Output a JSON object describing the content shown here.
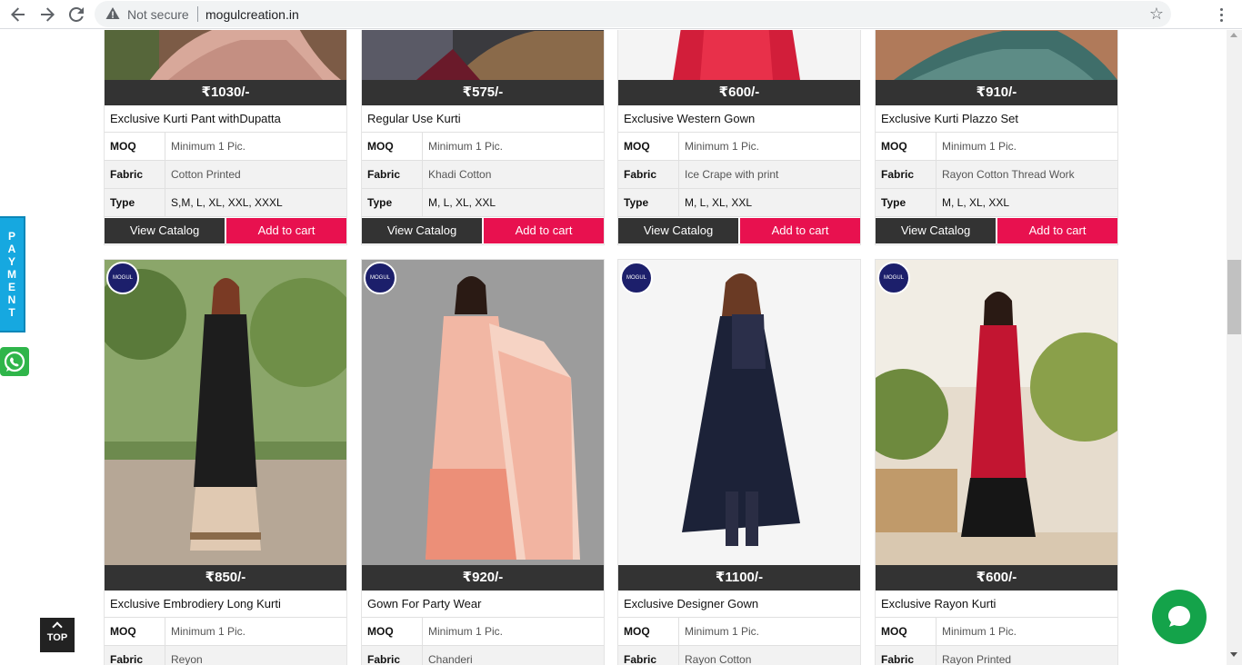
{
  "browser": {
    "security_label": "Not secure",
    "url": "mogulcreation.in"
  },
  "payment_tab": {
    "letters": [
      "P",
      "A",
      "Y",
      "M",
      "E",
      "N",
      "T"
    ]
  },
  "top_button": {
    "label": "TOP"
  },
  "table_labels": {
    "moq": "MOQ",
    "fabric": "Fabric",
    "type": "Type"
  },
  "buttons": {
    "view_catalog": "View Catalog",
    "add_to_cart": "Add to cart"
  },
  "logo_badge_text": "MOGUL",
  "row1": [
    {
      "price": "₹1030/-",
      "name": "Exclusive Kurti Pant withDupatta",
      "moq": "Minimum 1 Pic.",
      "fabric": "Cotton Printed",
      "type": "S,M, L, XL, XXL, XXXL"
    },
    {
      "price": "₹575/-",
      "name": "Regular Use Kurti",
      "moq": "Minimum 1 Pic.",
      "fabric": "Khadi Cotton",
      "type": "M, L, XL, XXL"
    },
    {
      "price": "₹600/-",
      "name": "Exclusive Western Gown",
      "moq": "Minimum 1 Pic.",
      "fabric": "Ice Crape with print",
      "type": "M, L, XL, XXL"
    },
    {
      "price": "₹910/-",
      "name": "Exclusive Kurti Plazzo Set",
      "moq": "Minimum 1 Pic.",
      "fabric": "Rayon Cotton Thread Work",
      "type": "M, L, XL, XXL"
    }
  ],
  "row2": [
    {
      "price": "₹850/-",
      "name": "Exclusive Embrodiery Long Kurti",
      "moq": "Minimum 1 Pic.",
      "fabric": "Reyon"
    },
    {
      "price": "₹920/-",
      "name": "Gown For Party Wear",
      "moq": "Minimum 1 Pic.",
      "fabric": "Chanderi"
    },
    {
      "price": "₹1100/-",
      "name": "Exclusive Designer Gown",
      "moq": "Minimum 1 Pic.",
      "fabric": "Rayon Cotton"
    },
    {
      "price": "₹600/-",
      "name": "Exclusive Rayon Kurti",
      "moq": "Minimum 1 Pic.",
      "fabric": "Rayon Printed"
    }
  ]
}
